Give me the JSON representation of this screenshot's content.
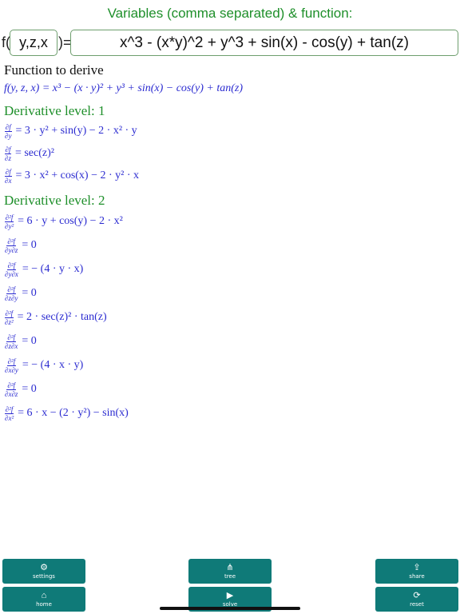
{
  "header": {
    "title": "Variables (comma separated) & function:"
  },
  "inputs": {
    "prefix": "f(",
    "variables": "y,z,x",
    "suffix": ")=",
    "function": "x^3 - (x*y)^2 + y^3 + sin(x) - cos(y) + tan(z)"
  },
  "content": {
    "heading": "Function to derive",
    "function_display": "f(y, z, x) = x³ − (x · y)² + y³ + sin(x) − cos(y) + tan(z)",
    "levels": [
      {
        "title": "Derivative level: 1",
        "items": [
          {
            "num": "∂f",
            "den": "∂y",
            "expr": "= 3 · y² + sin(y) − 2 · x² · y"
          },
          {
            "num": "∂f",
            "den": "∂z",
            "expr": "= sec(z)²"
          },
          {
            "num": "∂f",
            "den": "∂x",
            "expr": "= 3 · x² + cos(x) − 2 · y² · x"
          }
        ]
      },
      {
        "title": "Derivative level: 2",
        "items": [
          {
            "num": "∂²f",
            "den": "∂y²",
            "expr": "= 6 · y + cos(y) − 2 · x²"
          },
          {
            "num": "∂²f",
            "den": "∂y∂z",
            "expr": "= 0"
          },
          {
            "num": "∂²f",
            "den": "∂y∂x",
            "expr": "= − (4 · y · x)"
          },
          {
            "num": "∂²f",
            "den": "∂z∂y",
            "expr": "= 0"
          },
          {
            "num": "∂²f",
            "den": "∂z²",
            "expr": "= 2 · sec(z)² · tan(z)"
          },
          {
            "num": "∂²f",
            "den": "∂z∂x",
            "expr": "= 0"
          },
          {
            "num": "∂²f",
            "den": "∂x∂y",
            "expr": "= − (4 · x · y)"
          },
          {
            "num": "∂²f",
            "den": "∂x∂z",
            "expr": "= 0"
          },
          {
            "num": "∂²f",
            "den": "∂x²",
            "expr": "= 6 · x − (2 · y²) − sin(x)"
          }
        ]
      }
    ]
  },
  "toolbar": {
    "settings": {
      "label": "settings",
      "icon": "gear-icon"
    },
    "tree": {
      "label": "tree",
      "icon": "tree-icon"
    },
    "share": {
      "label": "share",
      "icon": "share-icon"
    },
    "home": {
      "label": "home",
      "icon": "home-icon"
    },
    "solve": {
      "label": "solve",
      "icon": "play-icon"
    },
    "reset": {
      "label": "reset",
      "icon": "reset-icon"
    }
  },
  "colors": {
    "accent_green": "#1e8f2a",
    "button_teal": "#0f7a78",
    "math_blue": "#2a2ad0"
  }
}
